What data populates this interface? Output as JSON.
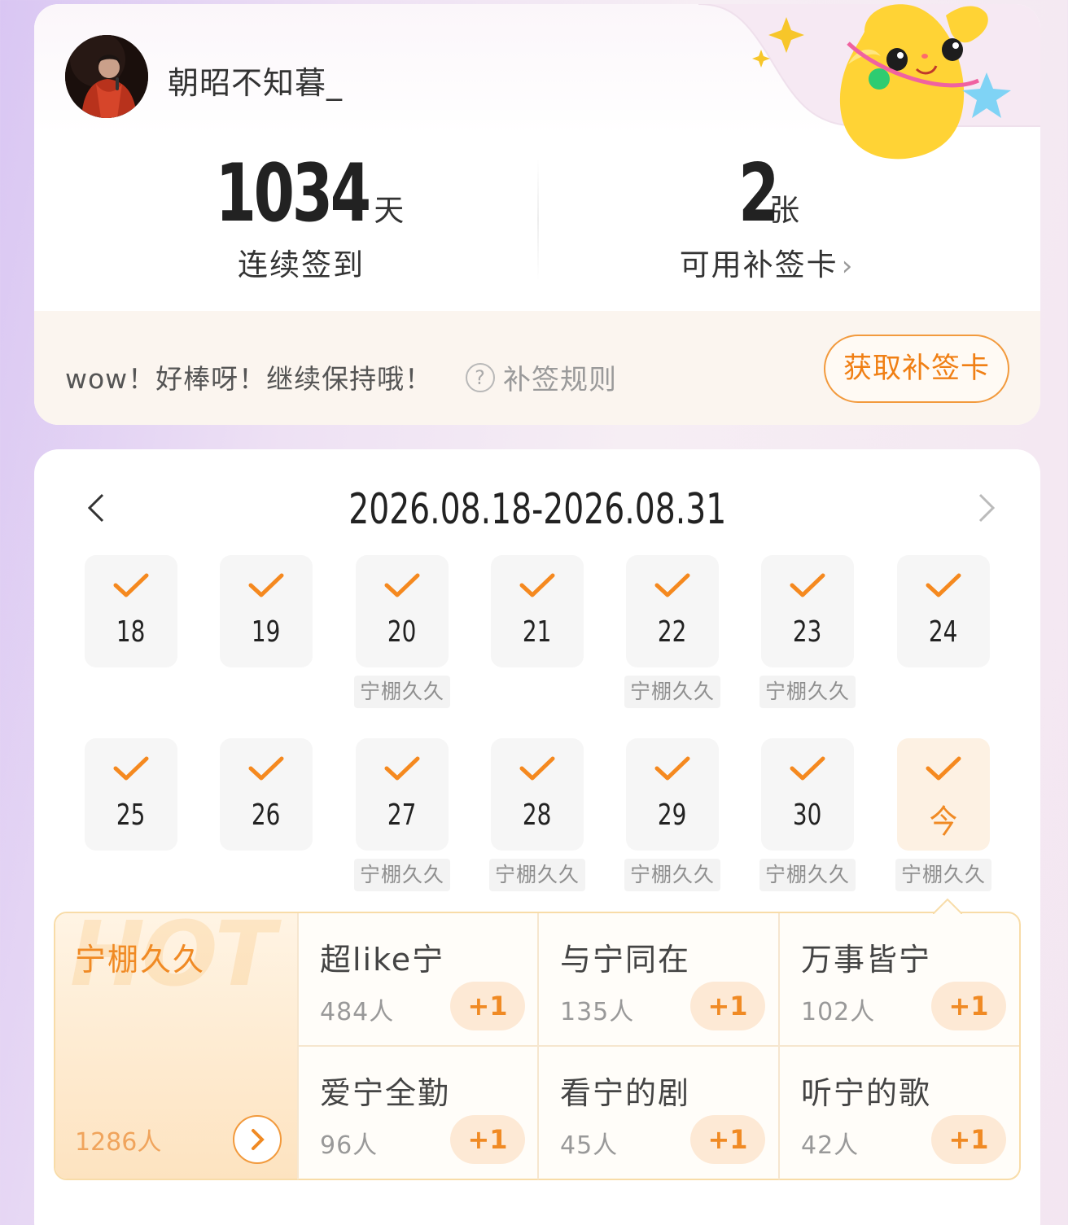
{
  "user": {
    "name": "朝昭不知暮_"
  },
  "stats": {
    "consecutive": {
      "value": "1034",
      "unit": "天",
      "label": "连续签到"
    },
    "makeup_cards": {
      "value": "2",
      "unit": "张",
      "label": "可用补签卡",
      "arrow": "›"
    }
  },
  "footer": {
    "encourage": "wow！好棒呀！继续保持哦！",
    "rules_icon": "?",
    "rules_label": "补签规则",
    "get_card_button": "获取补签卡"
  },
  "calendar": {
    "range": "2026.08.18-2026.08.31",
    "prev_icon": "chevron-left-icon",
    "next_icon": "chevron-right-icon",
    "week1": [
      {
        "day": "18",
        "checked": true,
        "tag": ""
      },
      {
        "day": "19",
        "checked": true,
        "tag": ""
      },
      {
        "day": "20",
        "checked": true,
        "tag": "宁棚久久"
      },
      {
        "day": "21",
        "checked": true,
        "tag": ""
      },
      {
        "day": "22",
        "checked": true,
        "tag": "宁棚久久"
      },
      {
        "day": "23",
        "checked": true,
        "tag": "宁棚久久"
      },
      {
        "day": "24",
        "checked": true,
        "tag": ""
      }
    ],
    "week2": [
      {
        "day": "25",
        "checked": true,
        "tag": ""
      },
      {
        "day": "26",
        "checked": true,
        "tag": ""
      },
      {
        "day": "27",
        "checked": true,
        "tag": "宁棚久久"
      },
      {
        "day": "28",
        "checked": true,
        "tag": "宁棚久久"
      },
      {
        "day": "29",
        "checked": true,
        "tag": "宁棚久久"
      },
      {
        "day": "30",
        "checked": true,
        "tag": "宁棚久久"
      },
      {
        "day": "今",
        "checked": true,
        "tag": "宁棚久久",
        "today": true
      }
    ]
  },
  "checkin_options": {
    "hot": {
      "watermark": "HOT",
      "name": "宁棚久久",
      "count": "1286人",
      "arrow": "›"
    },
    "items": [
      {
        "name": "超like宁",
        "count": "484人",
        "button": "+1"
      },
      {
        "name": "与宁同在",
        "count": "135人",
        "button": "+1"
      },
      {
        "name": "万事皆宁",
        "count": "102人",
        "button": "+1"
      },
      {
        "name": "爱宁全勤",
        "count": "96人",
        "button": "+1"
      },
      {
        "name": "看宁的剧",
        "count": "45人",
        "button": "+1"
      },
      {
        "name": "听宁的歌",
        "count": "42人",
        "button": "+1"
      }
    ]
  },
  "colors": {
    "accent": "#f08a24",
    "check": "#f5891f",
    "panel_border": "#f8dca8"
  }
}
